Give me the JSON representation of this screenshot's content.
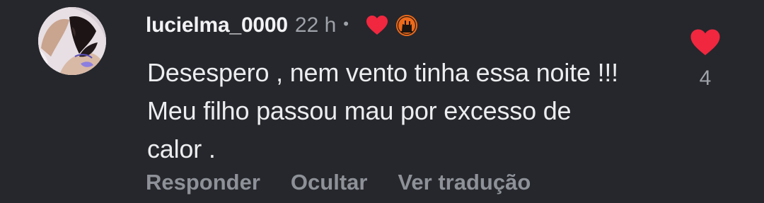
{
  "comment": {
    "username": "lucielma_0000",
    "time": "22 h",
    "separator": "•",
    "text": "Desespero , nem vento tinha essa noite !!! Meu filho passou mau por excesso de calor .",
    "like_count": "4",
    "actions": {
      "reply": "Responder",
      "hide": "Ocultar",
      "translate": "Ver tradução"
    },
    "icons": {
      "author_liked": "heart-icon",
      "badge": "fan-badge-icon",
      "like": "heart-icon"
    },
    "colors": {
      "background": "#25272c",
      "heart": "#f0273f",
      "badge": "#ee6a1b",
      "muted_text": "#8e9198"
    }
  }
}
